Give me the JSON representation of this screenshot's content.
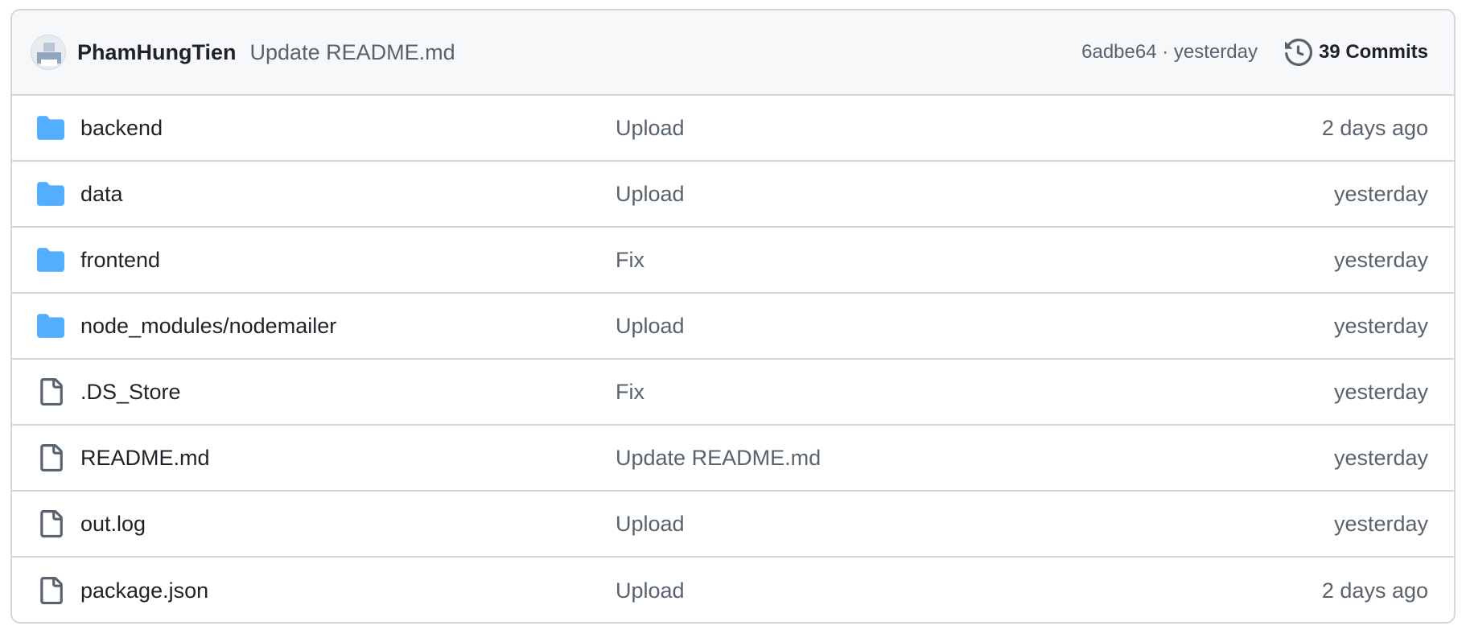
{
  "latest_commit": {
    "author": "PhamHungTien",
    "message": "Update README.md",
    "sha": "6adbe64",
    "separator": "·",
    "time": "yesterday",
    "sha_time": "6adbe64 · yesterday",
    "commits_label": "39 Commits"
  },
  "files": [
    {
      "icon": "folder-icon",
      "name": "backend",
      "commit": "Upload",
      "age": "2 days ago"
    },
    {
      "icon": "folder-icon",
      "name": "data",
      "commit": "Upload",
      "age": "yesterday"
    },
    {
      "icon": "folder-icon",
      "name": "frontend",
      "commit": "Fix",
      "age": "yesterday"
    },
    {
      "icon": "folder-icon",
      "name": "node_modules/nodemailer",
      "commit": "Upload",
      "age": "yesterday"
    },
    {
      "icon": "file-icon",
      "name": ".DS_Store",
      "commit": "Fix",
      "age": "yesterday"
    },
    {
      "icon": "file-icon",
      "name": "README.md",
      "commit": "Update README.md",
      "age": "yesterday"
    },
    {
      "icon": "file-icon",
      "name": "out.log",
      "commit": "Upload",
      "age": "yesterday"
    },
    {
      "icon": "file-icon",
      "name": "package.json",
      "commit": "Upload",
      "age": "2 days ago"
    }
  ],
  "colors": {
    "folder": "#54aeff",
    "border": "#d0d7de",
    "header_bg": "#f6f8fa",
    "text_primary": "#1f2328",
    "text_muted": "#59636e"
  }
}
